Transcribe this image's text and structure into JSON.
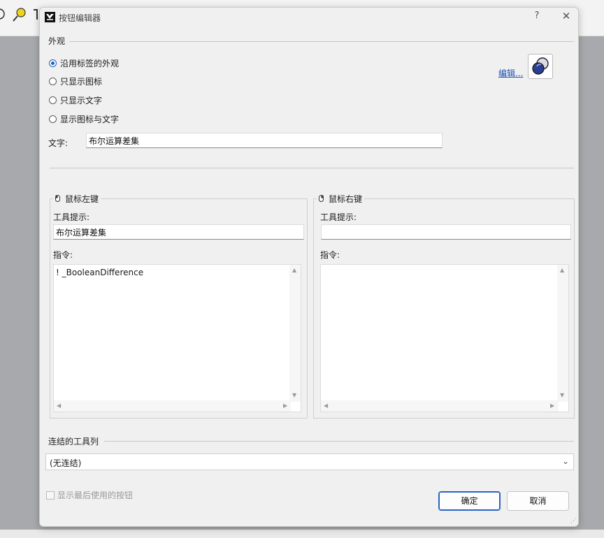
{
  "dialog": {
    "title": "按钮编辑器",
    "help_label": "?",
    "close_label": "✕"
  },
  "appearance": {
    "section_label": "外观",
    "options": [
      {
        "label": "沿用标签的外观",
        "checked": true
      },
      {
        "label": "只显示图标",
        "checked": false
      },
      {
        "label": "只显示文字",
        "checked": false
      },
      {
        "label": "显示图标与文字",
        "checked": false
      }
    ],
    "edit_link": "编辑...",
    "text_label": "文字:",
    "text_value": "布尔运算差集"
  },
  "left_mouse": {
    "title": "鼠标左键",
    "tooltip_label": "工具提示:",
    "tooltip_value": "布尔运算差集",
    "command_label": "指令:",
    "command_value": "! _BooleanDifference"
  },
  "right_mouse": {
    "title": "鼠标右键",
    "tooltip_label": "工具提示:",
    "tooltip_value": "",
    "command_label": "指令:",
    "command_value": ""
  },
  "linked_toolbar": {
    "section_label": "连结的工具列",
    "selected": "(无连结)"
  },
  "show_last_used": {
    "label": "显示最后使用的按钮",
    "checked": false,
    "enabled": false
  },
  "buttons": {
    "ok": "确定",
    "cancel": "取消"
  },
  "colors": {
    "accent": "#2b63c5",
    "link": "#1a4fb5"
  }
}
